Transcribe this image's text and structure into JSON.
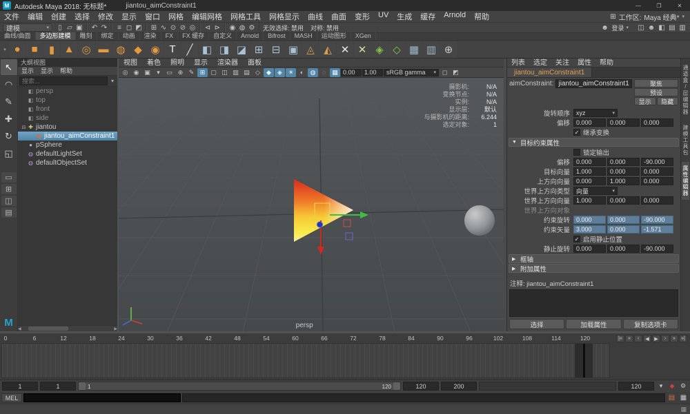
{
  "window": {
    "app_icon": "M",
    "title": "Autodesk Maya 2018: 无标题*",
    "document": "jiantou_aimConstraint1",
    "minimize": "—",
    "maximize": "❐",
    "close": "✕"
  },
  "menubar": {
    "items": [
      "文件",
      "编辑",
      "创建",
      "选择",
      "修改",
      "显示",
      "窗口",
      "网格",
      "编辑网格",
      "网格工具",
      "网格显示",
      "曲线",
      "曲面",
      "变形",
      "UV",
      "生成",
      "缓存",
      "Arnold",
      "帮助"
    ],
    "workspace_icon": "⊞",
    "workspace_label": "工作区:",
    "workspace_value": "Maya 经典*",
    "caret": "▾"
  },
  "statusline": {
    "mode": "建模",
    "icon_groups": [
      [
        {
          "name": "new-scene-icon",
          "glyph": "▯"
        },
        {
          "name": "open-scene-icon",
          "glyph": "▱"
        },
        {
          "name": "save-scene-icon",
          "glyph": "▣"
        }
      ],
      [
        {
          "name": "undo-icon",
          "glyph": "↶"
        },
        {
          "name": "redo-icon",
          "glyph": "↷"
        }
      ],
      [
        {
          "name": "select-hierarchy-icon",
          "glyph": "≡"
        },
        {
          "name": "select-object-icon",
          "glyph": "◻"
        },
        {
          "name": "select-component-icon",
          "glyph": "◩"
        }
      ],
      [
        {
          "name": "snap-grid-icon",
          "glyph": "⊞"
        },
        {
          "name": "snap-curve-icon",
          "glyph": "∿"
        },
        {
          "name": "snap-point-icon",
          "glyph": "⊙"
        },
        {
          "name": "snap-plane-icon",
          "glyph": "⊘"
        },
        {
          "name": "make-live-icon",
          "glyph": "◎"
        }
      ],
      [
        {
          "name": "input-connections-icon",
          "glyph": "⊲"
        },
        {
          "name": "output-connections-icon",
          "glyph": "⊳"
        }
      ],
      [
        {
          "name": "render-icon",
          "glyph": "◉"
        },
        {
          "name": "ipr-render-icon",
          "glyph": "◍"
        },
        {
          "name": "render-settings-icon",
          "glyph": "⚙"
        }
      ]
    ],
    "selection_status": "无效选择: 禁用",
    "symmetry_status": "对称: 禁用",
    "signin_icon": "☻",
    "signin_label": "登录",
    "right_icons": [
      {
        "name": "toggle-modeling-toolkit-icon",
        "glyph": "◫"
      },
      {
        "name": "toggle-humanik-icon",
        "glyph": "☻"
      },
      {
        "name": "toggle-attribute-editor-icon",
        "glyph": "◧"
      },
      {
        "name": "toggle-tool-settings-icon",
        "glyph": "▤"
      },
      {
        "name": "toggle-channel-box-icon",
        "glyph": "▥"
      }
    ]
  },
  "shelf": {
    "menu_icon": "▾",
    "tabs": [
      "曲线/曲面",
      "多边形建模",
      "雕刻",
      "绑定",
      "动画",
      "渲染",
      "FX",
      "FX 缓存",
      "自定义",
      "Arnold",
      "Bifrost",
      "MASH",
      "运动图形",
      "XGen"
    ],
    "active": "多边形建模",
    "icons": [
      {
        "name": "shelf-poly-sphere-icon",
        "glyph": "●",
        "color": "#e59a3f"
      },
      {
        "name": "shelf-poly-cube-icon",
        "glyph": "■",
        "color": "#e59a3f"
      },
      {
        "name": "shelf-poly-cylinder-icon",
        "glyph": "▮",
        "color": "#e59a3f"
      },
      {
        "name": "shelf-poly-cone-icon",
        "glyph": "▲",
        "color": "#e59a3f"
      },
      {
        "name": "shelf-poly-torus-icon",
        "glyph": "◎",
        "color": "#e59a3f"
      },
      {
        "name": "shelf-poly-plane-icon",
        "glyph": "▬",
        "color": "#e59a3f"
      },
      {
        "name": "shelf-poly-disc-icon",
        "glyph": "◍",
        "color": "#e59a3f"
      },
      {
        "name": "shelf-poly-platonic-icon",
        "glyph": "◆",
        "color": "#e59a3f"
      },
      {
        "name": "shelf-poly-pipe-icon",
        "glyph": "◉",
        "color": "#e59a3f"
      },
      {
        "name": "shelf-type-tool-icon",
        "glyph": "T",
        "color": "#f0f0f0"
      },
      {
        "name": "shelf-pencil-curve-icon",
        "glyph": "╱",
        "color": "#d8d8d8"
      },
      {
        "name": "shelf-boolean-union-icon",
        "glyph": "◧",
        "color": "#a9c2d4"
      },
      {
        "name": "shelf-boolean-difference-icon",
        "glyph": "◨",
        "color": "#a9c2d4"
      },
      {
        "name": "shelf-boolean-intersect-icon",
        "glyph": "◪",
        "color": "#a9c2d4"
      },
      {
        "name": "shelf-combine-icon",
        "glyph": "⊞",
        "color": "#a9c2d4"
      },
      {
        "name": "shelf-separate-icon",
        "glyph": "⊟",
        "color": "#a9c2d4"
      },
      {
        "name": "shelf-extrude-icon",
        "glyph": "▣",
        "color": "#a9c2d4"
      },
      {
        "name": "shelf-bevel-icon",
        "glyph": "◬",
        "color": "#d9a049"
      },
      {
        "name": "shelf-bridge-icon",
        "glyph": "◭",
        "color": "#d9a049"
      },
      {
        "name": "shelf-multi-cut-icon",
        "glyph": "✕",
        "color": "#e8e8e8"
      },
      {
        "name": "shelf-target-weld-icon",
        "glyph": "✕",
        "color": "#cfe0a0"
      },
      {
        "name": "shelf-quad-draw-icon",
        "glyph": "◈",
        "color": "#82c24e"
      },
      {
        "name": "shelf-mirror-icon",
        "glyph": "◇",
        "color": "#82c24e"
      },
      {
        "name": "shelf-smooth-icon",
        "glyph": "▦",
        "color": "#9fb8c8"
      },
      {
        "name": "shelf-crease-icon",
        "glyph": "▥",
        "color": "#9fb8c8"
      },
      {
        "name": "shelf-sculpt-icon",
        "glyph": "⊕",
        "color": "#c8c8c8"
      }
    ]
  },
  "toolbox": {
    "tools": [
      {
        "name": "select-tool-icon",
        "glyph": "↖",
        "active": true
      },
      {
        "name": "lasso-tool-icon",
        "glyph": "◠"
      },
      {
        "name": "paint-select-tool-icon",
        "glyph": "✎"
      },
      {
        "name": "move-tool-icon",
        "glyph": "✚"
      },
      {
        "name": "rotate-tool-icon",
        "glyph": "↻"
      },
      {
        "name": "scale-tool-icon",
        "glyph": "◱"
      }
    ],
    "layouts": [
      {
        "name": "layout-single-pane-icon",
        "glyph": "▭"
      },
      {
        "name": "layout-four-pane-icon",
        "glyph": "⊞"
      },
      {
        "name": "layout-outliner-persp-icon",
        "glyph": "◫"
      },
      {
        "name": "layout-hypershade-icon",
        "glyph": "▤"
      }
    ],
    "logo": "M"
  },
  "outliner": {
    "title": "大纲视图",
    "menus": [
      "显示",
      "显示",
      "帮助"
    ],
    "search_placeholder": "搜索...",
    "type_icons": {
      "camera": {
        "glyph": "◧",
        "color": "#9a9a9a"
      },
      "transform": {
        "glyph": "✚",
        "color": "#cfcf80"
      },
      "constraint": {
        "glyph": "◉",
        "color": "#d4703a"
      },
      "mesh": {
        "glyph": "●",
        "color": "#acb8c0"
      },
      "set": {
        "glyph": "◍",
        "color": "#b89ad4"
      }
    },
    "items": [
      {
        "label": "persp",
        "type": "camera",
        "dim": true
      },
      {
        "label": "top",
        "type": "camera",
        "dim": true
      },
      {
        "label": "front",
        "type": "camera",
        "dim": true
      },
      {
        "label": "side",
        "type": "camera",
        "dim": true
      },
      {
        "label": "jiantou",
        "type": "transform",
        "expanded": true
      },
      {
        "label": "jiantou_aimConstraint1",
        "type": "constraint",
        "selected": true,
        "indent": 1
      },
      {
        "label": "pSphere",
        "type": "mesh"
      },
      {
        "label": "defaultLightSet",
        "type": "set"
      },
      {
        "label": "defaultObjectSet",
        "type": "set"
      }
    ]
  },
  "viewport": {
    "menus": [
      "视图",
      "着色",
      "照明",
      "显示",
      "渲染器",
      "面板"
    ],
    "toolbar_left_icons": [
      {
        "name": "select-camera-icon",
        "glyph": "◎"
      },
      {
        "name": "lock-camera-icon",
        "glyph": "◉"
      },
      {
        "name": "camera-attributes-icon",
        "glyph": "▣"
      },
      {
        "name": "bookmarks-icon",
        "glyph": "▾"
      },
      {
        "name": "image-plane-icon",
        "glyph": "▭"
      },
      {
        "name": "pan-zoom-icon",
        "glyph": "⊕"
      },
      {
        "name": "grease-pencil-icon",
        "glyph": "✎"
      },
      {
        "name": "grid-toggle-icon",
        "glyph": "⊞",
        "active": true
      },
      {
        "name": "film-gate-icon",
        "glyph": "▢"
      },
      {
        "name": "resolution-gate-icon",
        "glyph": "◫"
      },
      {
        "name": "gate-mask-icon",
        "glyph": "▥"
      },
      {
        "name": "field-chart-icon",
        "glyph": "▤"
      },
      {
        "name": "wireframe-icon",
        "glyph": "◇"
      },
      {
        "name": "shaded-display-icon",
        "glyph": "◆",
        "active": true
      },
      {
        "name": "textured-display-icon",
        "glyph": "◈",
        "active": true
      },
      {
        "name": "lights-icon",
        "glyph": "☀",
        "active": true
      },
      {
        "name": "shadows-icon",
        "glyph": "◐"
      },
      {
        "name": "ao-icon",
        "glyph": "◍",
        "active": true
      },
      {
        "name": "motion-blur-icon",
        "glyph": "◌"
      },
      {
        "name": "antialias-icon",
        "glyph": "▦",
        "active": true
      }
    ],
    "exposure": "0.00",
    "gamma": "1.00",
    "colorspace": "sRGB gamma",
    "toolbar_right_icons": [
      {
        "name": "isolate-select-icon",
        "glyph": "◻"
      },
      {
        "name": "xray-icon",
        "glyph": "◩"
      }
    ],
    "hud": [
      {
        "label": "摄影机:",
        "value": "N/A"
      },
      {
        "label": "变换节点:",
        "value": "N/A"
      },
      {
        "label": "实例:",
        "value": "N/A"
      },
      {
        "label": "显示层:",
        "value": "默认"
      },
      {
        "label": "与摄影机的距离:",
        "value": "6.244"
      },
      {
        "label": "选定对象:",
        "value": "1"
      }
    ],
    "camera_label": "persp"
  },
  "attribute_editor": {
    "menus": [
      "列表",
      "选定",
      "关注",
      "属性",
      "帮助"
    ],
    "tab": "jiantou_aimConstraint1",
    "node_type_label": "aimConstraint:",
    "node_name": "jiantou_aimConstraint1",
    "buttons": {
      "focus": "聚焦",
      "presets": "预设",
      "show": "显示",
      "hide": "隐藏"
    },
    "rows": [
      {
        "kind": "dropdown",
        "label": "旋转顺序",
        "value": "xyz"
      },
      {
        "kind": "triple",
        "label": "偏移",
        "values": [
          "0.000",
          "0.000",
          "0.000"
        ]
      },
      {
        "kind": "checkbox",
        "label": "继承变换",
        "checked": true
      },
      {
        "kind": "section",
        "label": "目标约束属性",
        "expanded": true
      },
      {
        "kind": "checkbox",
        "label": "锁定输出",
        "checked": false
      },
      {
        "kind": "triple",
        "label": "偏移",
        "values": [
          "0.000",
          "0.000",
          "-90.000"
        ]
      },
      {
        "kind": "triple",
        "label": "目标向量",
        "values": [
          "1.000",
          "0.000",
          "0.000"
        ]
      },
      {
        "kind": "triple",
        "label": "上方向向量",
        "values": [
          "0.000",
          "1.000",
          "0.000"
        ]
      },
      {
        "kind": "dropdown",
        "label": "世界上方向类型",
        "value": "向量"
      },
      {
        "kind": "triple",
        "label": "世界上方向向量",
        "values": [
          "1.000",
          "0.000",
          "0.000"
        ]
      },
      {
        "kind": "plain",
        "label": "世界上方向对象"
      },
      {
        "kind": "triple",
        "label": "约束旋转",
        "values": [
          "0.000",
          "0.000",
          "-90.000"
        ],
        "highlight": true
      },
      {
        "kind": "triple",
        "label": "约束矢量",
        "values": [
          "3.000",
          "0.000",
          "-1.571"
        ],
        "highlight": true
      },
      {
        "kind": "checkbox",
        "label": "启用静止位置",
        "checked": true
      },
      {
        "kind": "triple",
        "label": "静止旋转",
        "values": [
          "0.000",
          "0.000",
          "-90.000"
        ]
      },
      {
        "kind": "section",
        "label": "框轴",
        "expanded": false
      },
      {
        "kind": "section",
        "label": "附加属性",
        "expanded": false
      }
    ],
    "notes_label": "注释: jiantou_aimConstraint1",
    "footer": {
      "select": "选择",
      "load": "加载属性",
      "copy": "复制选项卡"
    }
  },
  "right_strip": {
    "tabs": [
      {
        "label": "通道盒/层编辑器",
        "active": false
      },
      {
        "label": "建模工具包",
        "active": false
      },
      {
        "label": "属性编辑器",
        "active": true
      }
    ]
  },
  "timeline": {
    "tick_labels": [
      0,
      6,
      12,
      18,
      24,
      30,
      36,
      42,
      48,
      54,
      60,
      66,
      72,
      78,
      84,
      90,
      96,
      102,
      108,
      114,
      120
    ],
    "current_frame": "120",
    "playback_buttons": [
      {
        "name": "go-to-start-button",
        "glyph": "|«"
      },
      {
        "name": "step-back-frame-button",
        "glyph": "«"
      },
      {
        "name": "step-back-key-button",
        "glyph": "‹"
      },
      {
        "name": "play-backwards-button",
        "glyph": "◀"
      },
      {
        "name": "play-forwards-button",
        "glyph": "▶"
      },
      {
        "name": "step-forward-key-button",
        "glyph": "›"
      },
      {
        "name": "step-forward-frame-button",
        "glyph": "»"
      },
      {
        "name": "go-to-end-button",
        "glyph": "»|"
      }
    ]
  },
  "range_slider": {
    "anim_start": "1",
    "playback_start": "1",
    "range_start_label": "1",
    "range_end_label": "120",
    "playback_end": "120",
    "anim_end": "200",
    "current_time": "120",
    "icons": [
      {
        "name": "character-set-selector-icon",
        "glyph": "▾"
      },
      {
        "name": "auto-keyframe-button",
        "glyph": "◆",
        "color": "#cc4040"
      },
      {
        "name": "animation-preferences-button",
        "glyph": "⚙"
      }
    ]
  },
  "command_line": {
    "label": "MEL",
    "input_value": "",
    "icons": [
      {
        "name": "command-output-icon",
        "glyph": "▤",
        "color": "#cc7744"
      },
      {
        "name": "script-editor-icon",
        "glyph": "▦",
        "color": "#c8c8c8"
      }
    ]
  },
  "help_line": {
    "text": "",
    "icon": "▦"
  }
}
